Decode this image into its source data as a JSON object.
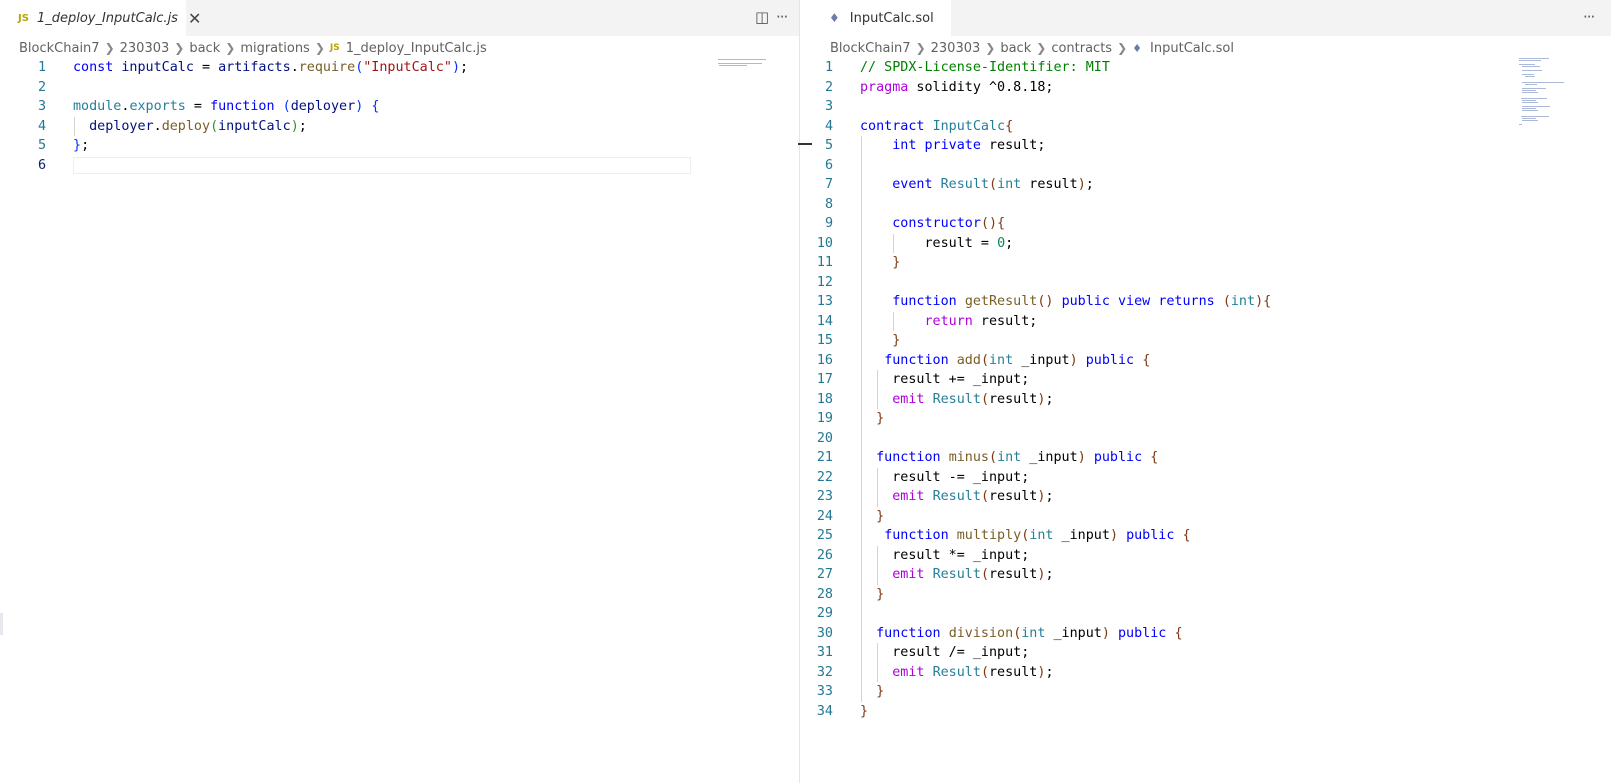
{
  "left": {
    "tab": {
      "icon": "JS",
      "label": "1_deploy_InputCalc.js",
      "close": "✕"
    },
    "actions": {
      "split": "◫",
      "more": "···"
    },
    "breadcrumb": {
      "parts": [
        "BlockChain7",
        "230303",
        "back",
        "migrations"
      ],
      "file_icon": "JS",
      "file": "1_deploy_InputCalc.js"
    },
    "lines": [
      {
        "n": "1",
        "html": "<span class=\"kw\">const</span> <span class=\"var\">inputCalc</span> = <span class=\"var\">artifacts</span>.<span class=\"fn\">require</span><span class=\"br1\">(</span><span class=\"str\">\"InputCalc\"</span><span class=\"br1\">)</span>;"
      },
      {
        "n": "2",
        "html": ""
      },
      {
        "n": "3",
        "html": "<span class=\"ty\">module</span>.<span class=\"ty\">exports</span> = <span class=\"kw\">function</span> <span class=\"br1\">(</span><span class=\"var\">deployer</span><span class=\"br1\">)</span> <span class=\"br1\">{</span>"
      },
      {
        "n": "4",
        "html": "  <span class=\"var\">deployer</span>.<span class=\"fn\">deploy</span><span class=\"br2\">(</span><span class=\"var\">inputCalc</span><span class=\"br2\">)</span>;"
      },
      {
        "n": "5",
        "html": "<span class=\"br1\">}</span>;"
      },
      {
        "n": "6",
        "html": ""
      }
    ]
  },
  "right": {
    "tab": {
      "icon": "♦",
      "label": "InputCalc.sol"
    },
    "actions": {
      "more": "···"
    },
    "breadcrumb": {
      "parts": [
        "BlockChain7",
        "230303",
        "back",
        "contracts"
      ],
      "file_icon": "♦",
      "file": "InputCalc.sol"
    },
    "lines": [
      {
        "n": "1",
        "html": "<span class=\"cm\">// SPDX-License-Identifier: MIT</span>"
      },
      {
        "n": "2",
        "html": "<span class=\"kw2\">pragma</span> solidity ^0.8.18;"
      },
      {
        "n": "3",
        "html": ""
      },
      {
        "n": "4",
        "html": "<span class=\"kw\">contract</span> <span class=\"ty\">InputCalc</span><span class=\"br3\">{</span>"
      },
      {
        "n": "5",
        "html": "    <span class=\"kw\">int</span> <span class=\"kw\">private</span> result;"
      },
      {
        "n": "6",
        "html": ""
      },
      {
        "n": "7",
        "html": "    <span class=\"kw\">event</span> <span class=\"ty\">Result</span><span class=\"br3\">(</span><span class=\"ty\">int</span> result<span class=\"br3\">)</span>;"
      },
      {
        "n": "8",
        "html": ""
      },
      {
        "n": "9",
        "html": "    <span class=\"kw\">constructor</span><span class=\"br3\">(){</span>"
      },
      {
        "n": "10",
        "html": "        result = <span class=\"num\">0</span>;"
      },
      {
        "n": "11",
        "html": "    <span class=\"br3\">}</span>"
      },
      {
        "n": "12",
        "html": ""
      },
      {
        "n": "13",
        "html": "    <span class=\"kw\">function</span> <span class=\"fn\">getResult</span><span class=\"br3\">()</span> <span class=\"kw\">public</span> <span class=\"kw\">view</span> <span class=\"kw\">returns</span> <span class=\"br3\">(</span><span class=\"ty\">int</span><span class=\"br3\">){</span>"
      },
      {
        "n": "14",
        "html": "        <span class=\"kw2\">return</span> result;"
      },
      {
        "n": "15",
        "html": "    <span class=\"br3\">}</span>"
      },
      {
        "n": "16",
        "html": "   <span class=\"kw\">function</span> <span class=\"fn\">add</span><span class=\"br3\">(</span><span class=\"ty\">int</span> _input<span class=\"br3\">)</span> <span class=\"kw\">public</span> <span class=\"br3\">{</span>"
      },
      {
        "n": "17",
        "html": "    result += _input;"
      },
      {
        "n": "18",
        "html": "    <span class=\"kw2\">emit</span> <span class=\"ty\">Result</span><span class=\"br3\">(</span>result<span class=\"br3\">)</span>;"
      },
      {
        "n": "19",
        "html": "  <span class=\"br3\">}</span>"
      },
      {
        "n": "20",
        "html": ""
      },
      {
        "n": "21",
        "html": "  <span class=\"kw\">function</span> <span class=\"fn\">minus</span><span class=\"br3\">(</span><span class=\"ty\">int</span> _input<span class=\"br3\">)</span> <span class=\"kw\">public</span> <span class=\"br3\">{</span>"
      },
      {
        "n": "22",
        "html": "    result -= _input;"
      },
      {
        "n": "23",
        "html": "    <span class=\"kw2\">emit</span> <span class=\"ty\">Result</span><span class=\"br3\">(</span>result<span class=\"br3\">)</span>;"
      },
      {
        "n": "24",
        "html": "  <span class=\"br3\">}</span>"
      },
      {
        "n": "25",
        "html": "   <span class=\"kw\">function</span> <span class=\"fn\">multiply</span><span class=\"br3\">(</span><span class=\"ty\">int</span> _input<span class=\"br3\">)</span> <span class=\"kw\">public</span> <span class=\"br3\">{</span>"
      },
      {
        "n": "26",
        "html": "    result *= _input;"
      },
      {
        "n": "27",
        "html": "    <span class=\"kw2\">emit</span> <span class=\"ty\">Result</span><span class=\"br3\">(</span>result<span class=\"br3\">)</span>;"
      },
      {
        "n": "28",
        "html": "  <span class=\"br3\">}</span>"
      },
      {
        "n": "29",
        "html": ""
      },
      {
        "n": "30",
        "html": "  <span class=\"kw\">function</span> <span class=\"fn\">division</span><span class=\"br3\">(</span><span class=\"ty\">int</span> _input<span class=\"br3\">)</span> <span class=\"kw\">public</span> <span class=\"br3\">{</span>"
      },
      {
        "n": "31",
        "html": "    result /= _input;"
      },
      {
        "n": "32",
        "html": "    <span class=\"kw2\">emit</span> <span class=\"ty\">Result</span><span class=\"br3\">(</span>result<span class=\"br3\">)</span>;"
      },
      {
        "n": "33",
        "html": "  <span class=\"br3\">}</span>"
      },
      {
        "n": "34",
        "html": "<span class=\"br3\">}</span>"
      }
    ]
  }
}
